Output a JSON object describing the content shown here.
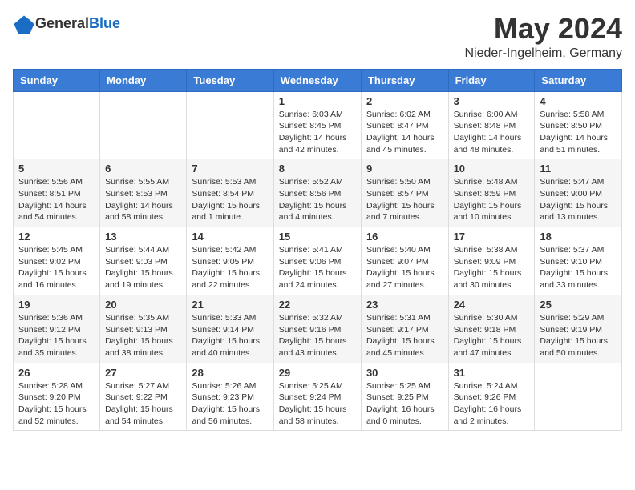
{
  "header": {
    "logo_general": "General",
    "logo_blue": "Blue",
    "month": "May 2024",
    "location": "Nieder-Ingelheim, Germany"
  },
  "weekdays": [
    "Sunday",
    "Monday",
    "Tuesday",
    "Wednesday",
    "Thursday",
    "Friday",
    "Saturday"
  ],
  "weeks": [
    [
      {
        "day": "",
        "info": ""
      },
      {
        "day": "",
        "info": ""
      },
      {
        "day": "",
        "info": ""
      },
      {
        "day": "1",
        "info": "Sunrise: 6:03 AM\nSunset: 8:45 PM\nDaylight: 14 hours\nand 42 minutes."
      },
      {
        "day": "2",
        "info": "Sunrise: 6:02 AM\nSunset: 8:47 PM\nDaylight: 14 hours\nand 45 minutes."
      },
      {
        "day": "3",
        "info": "Sunrise: 6:00 AM\nSunset: 8:48 PM\nDaylight: 14 hours\nand 48 minutes."
      },
      {
        "day": "4",
        "info": "Sunrise: 5:58 AM\nSunset: 8:50 PM\nDaylight: 14 hours\nand 51 minutes."
      }
    ],
    [
      {
        "day": "5",
        "info": "Sunrise: 5:56 AM\nSunset: 8:51 PM\nDaylight: 14 hours\nand 54 minutes."
      },
      {
        "day": "6",
        "info": "Sunrise: 5:55 AM\nSunset: 8:53 PM\nDaylight: 14 hours\nand 58 minutes."
      },
      {
        "day": "7",
        "info": "Sunrise: 5:53 AM\nSunset: 8:54 PM\nDaylight: 15 hours\nand 1 minute."
      },
      {
        "day": "8",
        "info": "Sunrise: 5:52 AM\nSunset: 8:56 PM\nDaylight: 15 hours\nand 4 minutes."
      },
      {
        "day": "9",
        "info": "Sunrise: 5:50 AM\nSunset: 8:57 PM\nDaylight: 15 hours\nand 7 minutes."
      },
      {
        "day": "10",
        "info": "Sunrise: 5:48 AM\nSunset: 8:59 PM\nDaylight: 15 hours\nand 10 minutes."
      },
      {
        "day": "11",
        "info": "Sunrise: 5:47 AM\nSunset: 9:00 PM\nDaylight: 15 hours\nand 13 minutes."
      }
    ],
    [
      {
        "day": "12",
        "info": "Sunrise: 5:45 AM\nSunset: 9:02 PM\nDaylight: 15 hours\nand 16 minutes."
      },
      {
        "day": "13",
        "info": "Sunrise: 5:44 AM\nSunset: 9:03 PM\nDaylight: 15 hours\nand 19 minutes."
      },
      {
        "day": "14",
        "info": "Sunrise: 5:42 AM\nSunset: 9:05 PM\nDaylight: 15 hours\nand 22 minutes."
      },
      {
        "day": "15",
        "info": "Sunrise: 5:41 AM\nSunset: 9:06 PM\nDaylight: 15 hours\nand 24 minutes."
      },
      {
        "day": "16",
        "info": "Sunrise: 5:40 AM\nSunset: 9:07 PM\nDaylight: 15 hours\nand 27 minutes."
      },
      {
        "day": "17",
        "info": "Sunrise: 5:38 AM\nSunset: 9:09 PM\nDaylight: 15 hours\nand 30 minutes."
      },
      {
        "day": "18",
        "info": "Sunrise: 5:37 AM\nSunset: 9:10 PM\nDaylight: 15 hours\nand 33 minutes."
      }
    ],
    [
      {
        "day": "19",
        "info": "Sunrise: 5:36 AM\nSunset: 9:12 PM\nDaylight: 15 hours\nand 35 minutes."
      },
      {
        "day": "20",
        "info": "Sunrise: 5:35 AM\nSunset: 9:13 PM\nDaylight: 15 hours\nand 38 minutes."
      },
      {
        "day": "21",
        "info": "Sunrise: 5:33 AM\nSunset: 9:14 PM\nDaylight: 15 hours\nand 40 minutes."
      },
      {
        "day": "22",
        "info": "Sunrise: 5:32 AM\nSunset: 9:16 PM\nDaylight: 15 hours\nand 43 minutes."
      },
      {
        "day": "23",
        "info": "Sunrise: 5:31 AM\nSunset: 9:17 PM\nDaylight: 15 hours\nand 45 minutes."
      },
      {
        "day": "24",
        "info": "Sunrise: 5:30 AM\nSunset: 9:18 PM\nDaylight: 15 hours\nand 47 minutes."
      },
      {
        "day": "25",
        "info": "Sunrise: 5:29 AM\nSunset: 9:19 PM\nDaylight: 15 hours\nand 50 minutes."
      }
    ],
    [
      {
        "day": "26",
        "info": "Sunrise: 5:28 AM\nSunset: 9:20 PM\nDaylight: 15 hours\nand 52 minutes."
      },
      {
        "day": "27",
        "info": "Sunrise: 5:27 AM\nSunset: 9:22 PM\nDaylight: 15 hours\nand 54 minutes."
      },
      {
        "day": "28",
        "info": "Sunrise: 5:26 AM\nSunset: 9:23 PM\nDaylight: 15 hours\nand 56 minutes."
      },
      {
        "day": "29",
        "info": "Sunrise: 5:25 AM\nSunset: 9:24 PM\nDaylight: 15 hours\nand 58 minutes."
      },
      {
        "day": "30",
        "info": "Sunrise: 5:25 AM\nSunset: 9:25 PM\nDaylight: 16 hours\nand 0 minutes."
      },
      {
        "day": "31",
        "info": "Sunrise: 5:24 AM\nSunset: 9:26 PM\nDaylight: 16 hours\nand 2 minutes."
      },
      {
        "day": "",
        "info": ""
      }
    ]
  ]
}
